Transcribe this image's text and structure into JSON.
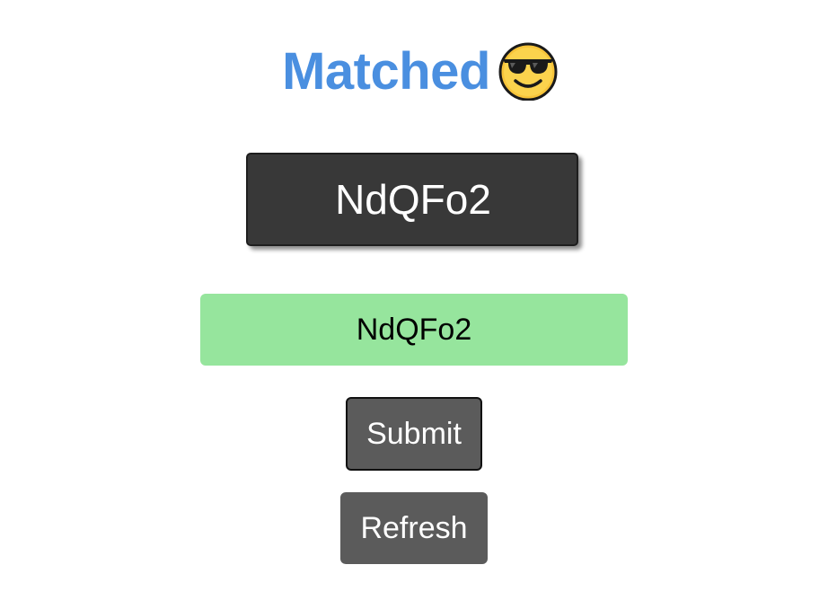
{
  "status": {
    "text": "Matched",
    "icon": "sunglasses-face-emoji",
    "color": "#4a8fe0"
  },
  "captcha": {
    "text": "NdQFo2"
  },
  "answer": {
    "value": "NdQFo2",
    "background": "#96e59d"
  },
  "buttons": {
    "submit_label": "Submit",
    "refresh_label": "Refresh"
  }
}
